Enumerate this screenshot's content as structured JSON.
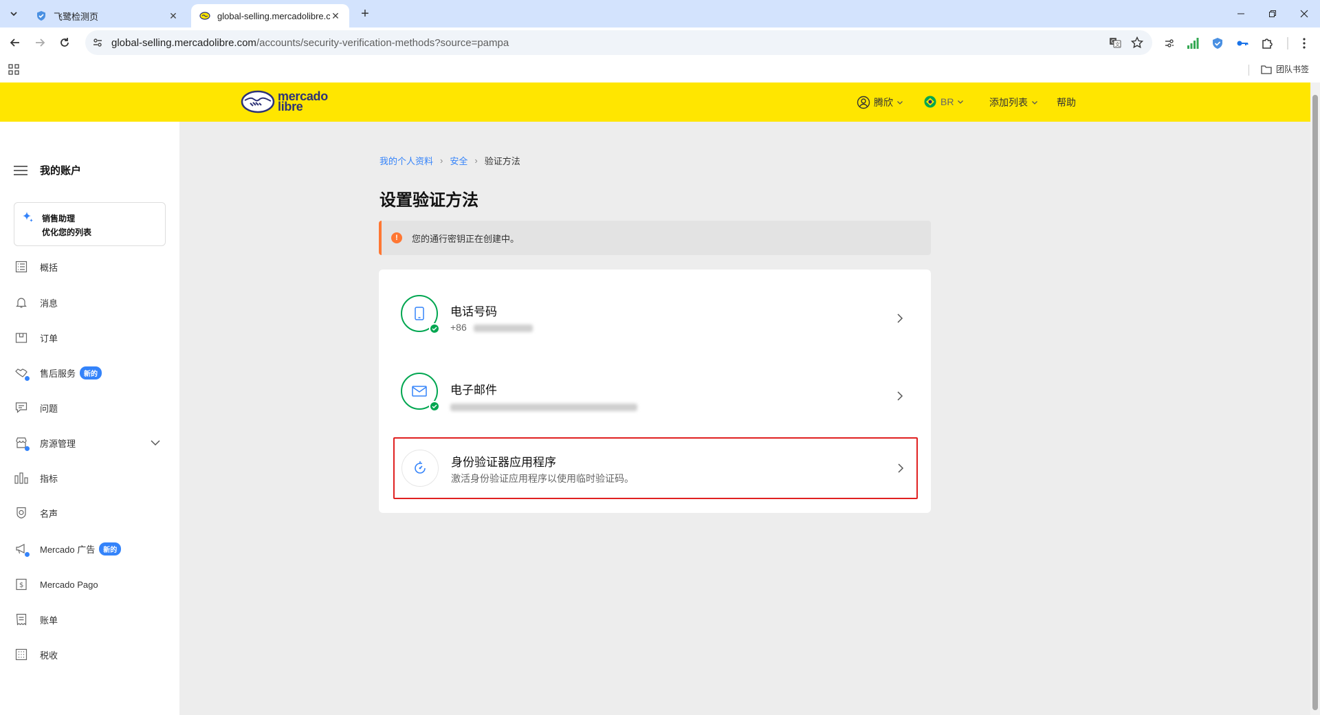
{
  "browser": {
    "tabs": [
      {
        "title": "飞鹭检测页",
        "active": false
      },
      {
        "title": "global-selling.mercadolibre.com",
        "active": true
      }
    ],
    "url_host": "global-selling.mercadolibre.com",
    "url_path": "/accounts/security-verification-methods?source=pampa",
    "bookmark_folder": "团队书签"
  },
  "header": {
    "logo_line1": "mercado",
    "logo_line2": "libre",
    "user_name": "腾欣",
    "country": "BR",
    "add_list": "添加列表",
    "help": "帮助"
  },
  "sidebar": {
    "title": "我的账户",
    "assistant_title": "销售助理",
    "assistant_subtitle": "优化您的列表",
    "items": [
      {
        "label": "概括",
        "icon": "list-icon"
      },
      {
        "label": "消息",
        "icon": "bell-icon"
      },
      {
        "label": "订单",
        "icon": "box-icon"
      },
      {
        "label": "售后服务",
        "icon": "handshake-icon",
        "badge": "新的"
      },
      {
        "label": "问题",
        "icon": "chat-icon"
      },
      {
        "label": "房源管理",
        "icon": "store-icon"
      },
      {
        "label": "指标",
        "icon": "bar-chart-icon"
      },
      {
        "label": "名声",
        "icon": "medal-icon"
      },
      {
        "label": "Mercado 广告",
        "icon": "megaphone-icon",
        "badge": "新的"
      },
      {
        "label": "Mercado Pago",
        "icon": "dollar-icon"
      },
      {
        "label": "账单",
        "icon": "receipt-icon"
      },
      {
        "label": "税收",
        "icon": "calculator-icon"
      }
    ]
  },
  "main": {
    "breadcrumb": {
      "profile": "我的个人资料",
      "security": "安全",
      "current": "验证方法"
    },
    "title": "设置验证方法",
    "alert": "您的通行密钥正在创建中。",
    "methods": [
      {
        "title": "电话号码",
        "subtitle": "+86",
        "verified": true
      },
      {
        "title": "电子邮件",
        "subtitle": "",
        "verified": true
      },
      {
        "title": "身份验证器应用程序",
        "subtitle": "激活身份验证应用程序以使用临时验证码。",
        "verified": false
      }
    ]
  },
  "colors": {
    "brand_yellow": "#ffe600",
    "link_blue": "#3483fa",
    "success_green": "#00a650",
    "warning_orange": "#ff7733",
    "highlight_red": "#e02020"
  }
}
